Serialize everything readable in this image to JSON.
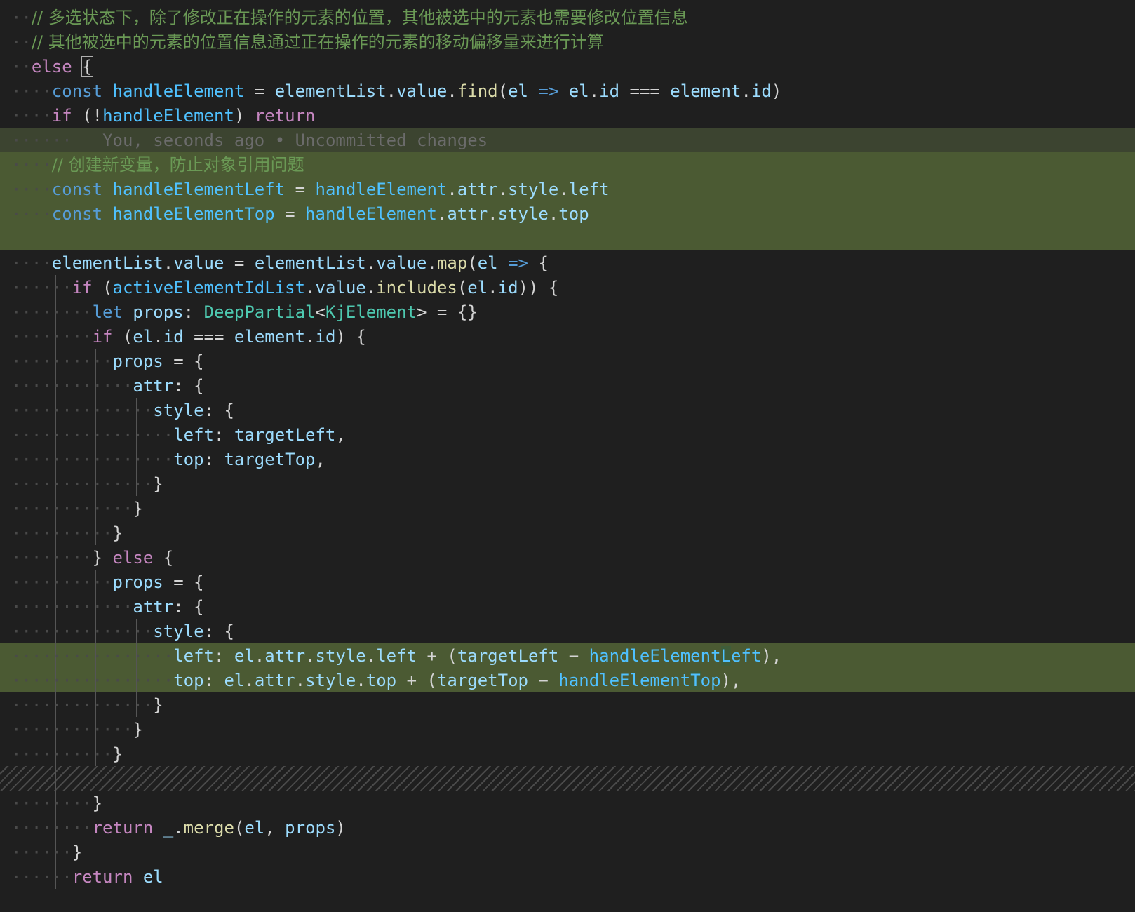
{
  "editor": {
    "blame_text": "You, seconds ago • Uncommitted changes",
    "lines": [
      {
        "indent": 1,
        "tokens": [
          [
            "cm",
            "// 多选状态下，除了修改正在操作的元素的位置，其他被选中的元素也需要修改位置信息"
          ]
        ]
      },
      {
        "indent": 1,
        "tokens": [
          [
            "cm",
            "// 其他被选中的元素的位置信息通过正在操作的元素的移动偏移量来进行计算"
          ]
        ]
      },
      {
        "indent": 1,
        "tokens": [
          [
            "kw",
            "else"
          ],
          [
            "pu",
            " "
          ],
          [
            "bracket",
            "{"
          ]
        ]
      },
      {
        "indent": 2,
        "tokens": [
          [
            "st",
            "const"
          ],
          [
            "pu",
            " "
          ],
          [
            "cn",
            "handleElement"
          ],
          [
            "op",
            " = "
          ],
          [
            "va",
            "elementList"
          ],
          [
            "pu",
            "."
          ],
          [
            "pr",
            "value"
          ],
          [
            "pu",
            "."
          ],
          [
            "fn",
            "find"
          ],
          [
            "pu",
            "("
          ],
          [
            "va",
            "el"
          ],
          [
            "pu",
            " "
          ],
          [
            "st",
            "=>"
          ],
          [
            "pu",
            " "
          ],
          [
            "va",
            "el"
          ],
          [
            "pu",
            "."
          ],
          [
            "pr",
            "id"
          ],
          [
            "op",
            " === "
          ],
          [
            "va",
            "element"
          ],
          [
            "pu",
            "."
          ],
          [
            "pr",
            "id"
          ],
          [
            "pu",
            ")"
          ]
        ]
      },
      {
        "indent": 2,
        "tokens": [
          [
            "kw",
            "if"
          ],
          [
            "pu",
            " ("
          ],
          [
            "op",
            "!"
          ],
          [
            "cn",
            "handleElement"
          ],
          [
            "pu",
            ") "
          ],
          [
            "kw",
            "return"
          ]
        ]
      },
      {
        "indent": 0,
        "blame": true,
        "tokens": []
      },
      {
        "indent": 2,
        "tokens": [
          [
            "cm",
            "// 创建新变量，防止对象引用问题"
          ]
        ]
      },
      {
        "indent": 2,
        "tokens": [
          [
            "st",
            "const"
          ],
          [
            "pu",
            " "
          ],
          [
            "cn",
            "handleElementLeft"
          ],
          [
            "op",
            " = "
          ],
          [
            "cn",
            "handleElement"
          ],
          [
            "pu",
            "."
          ],
          [
            "pr",
            "attr"
          ],
          [
            "pu",
            "."
          ],
          [
            "pr",
            "style"
          ],
          [
            "pu",
            "."
          ],
          [
            "pr",
            "left"
          ]
        ]
      },
      {
        "indent": 2,
        "tokens": [
          [
            "st",
            "const"
          ],
          [
            "pu",
            " "
          ],
          [
            "cn",
            "handleElementTop"
          ],
          [
            "op",
            " = "
          ],
          [
            "cn",
            "handleElement"
          ],
          [
            "pu",
            "."
          ],
          [
            "pr",
            "attr"
          ],
          [
            "pu",
            "."
          ],
          [
            "pr",
            "style"
          ],
          [
            "pu",
            "."
          ],
          [
            "pr",
            "top"
          ]
        ]
      },
      {
        "indent": 0,
        "tokens": []
      },
      {
        "indent": 2,
        "tokens": [
          [
            "va",
            "elementList"
          ],
          [
            "pu",
            "."
          ],
          [
            "pr",
            "value"
          ],
          [
            "op",
            " = "
          ],
          [
            "va",
            "elementList"
          ],
          [
            "pu",
            "."
          ],
          [
            "pr",
            "value"
          ],
          [
            "pu",
            "."
          ],
          [
            "fn",
            "map"
          ],
          [
            "pu",
            "("
          ],
          [
            "va",
            "el"
          ],
          [
            "pu",
            " "
          ],
          [
            "st",
            "=>"
          ],
          [
            "pu",
            " {"
          ]
        ]
      },
      {
        "indent": 3,
        "tokens": [
          [
            "kw",
            "if"
          ],
          [
            "pu",
            " ("
          ],
          [
            "cn",
            "activeElementIdList"
          ],
          [
            "pu",
            "."
          ],
          [
            "pr",
            "value"
          ],
          [
            "pu",
            "."
          ],
          [
            "fn",
            "includes"
          ],
          [
            "pu",
            "("
          ],
          [
            "va",
            "el"
          ],
          [
            "pu",
            "."
          ],
          [
            "pr",
            "id"
          ],
          [
            "pu",
            ")) {"
          ]
        ]
      },
      {
        "indent": 4,
        "tokens": [
          [
            "st",
            "let"
          ],
          [
            "pu",
            " "
          ],
          [
            "va",
            "props"
          ],
          [
            "pu",
            ": "
          ],
          [
            "ty",
            "DeepPartial"
          ],
          [
            "pu",
            "<"
          ],
          [
            "ty",
            "KjElement"
          ],
          [
            "pu",
            ">"
          ],
          [
            "op",
            " = "
          ],
          [
            "pu",
            "{}"
          ]
        ]
      },
      {
        "indent": 4,
        "tokens": [
          [
            "kw",
            "if"
          ],
          [
            "pu",
            " ("
          ],
          [
            "va",
            "el"
          ],
          [
            "pu",
            "."
          ],
          [
            "pr",
            "id"
          ],
          [
            "op",
            " === "
          ],
          [
            "va",
            "element"
          ],
          [
            "pu",
            "."
          ],
          [
            "pr",
            "id"
          ],
          [
            "pu",
            ") {"
          ]
        ]
      },
      {
        "indent": 5,
        "tokens": [
          [
            "va",
            "props"
          ],
          [
            "op",
            " = "
          ],
          [
            "pu",
            "{"
          ]
        ]
      },
      {
        "indent": 6,
        "tokens": [
          [
            "pr",
            "attr"
          ],
          [
            "pu",
            ": {"
          ]
        ]
      },
      {
        "indent": 7,
        "tokens": [
          [
            "pr",
            "style"
          ],
          [
            "pu",
            ": {"
          ]
        ]
      },
      {
        "indent": 8,
        "tokens": [
          [
            "pr",
            "left"
          ],
          [
            "pu",
            ": "
          ],
          [
            "va",
            "targetLeft"
          ],
          [
            "pu",
            ","
          ]
        ]
      },
      {
        "indent": 8,
        "tokens": [
          [
            "pr",
            "top"
          ],
          [
            "pu",
            ": "
          ],
          [
            "va",
            "targetTop"
          ],
          [
            "pu",
            ","
          ]
        ]
      },
      {
        "indent": 7,
        "tokens": [
          [
            "pu",
            "}"
          ]
        ]
      },
      {
        "indent": 6,
        "tokens": [
          [
            "pu",
            "}"
          ]
        ]
      },
      {
        "indent": 5,
        "tokens": [
          [
            "pu",
            "}"
          ]
        ]
      },
      {
        "indent": 4,
        "tokens": [
          [
            "pu",
            "} "
          ],
          [
            "kw",
            "else"
          ],
          [
            "pu",
            " {"
          ]
        ]
      },
      {
        "indent": 5,
        "tokens": [
          [
            "va",
            "props"
          ],
          [
            "op",
            " = "
          ],
          [
            "pu",
            "{"
          ]
        ]
      },
      {
        "indent": 6,
        "tokens": [
          [
            "pr",
            "attr"
          ],
          [
            "pu",
            ": {"
          ]
        ]
      },
      {
        "indent": 7,
        "tokens": [
          [
            "pr",
            "style"
          ],
          [
            "pu",
            ": {"
          ]
        ]
      },
      {
        "indent": 8,
        "tokens": [
          [
            "pr",
            "left"
          ],
          [
            "pu",
            ": "
          ],
          [
            "va",
            "el"
          ],
          [
            "pu",
            "."
          ],
          [
            "pr",
            "attr"
          ],
          [
            "pu",
            "."
          ],
          [
            "pr",
            "style"
          ],
          [
            "pu",
            "."
          ],
          [
            "pr",
            "left"
          ],
          [
            "op",
            " + "
          ],
          [
            "pu",
            "("
          ],
          [
            "va",
            "targetLeft"
          ],
          [
            "op",
            " − "
          ],
          [
            "cn",
            "handleElement"
          ],
          [
            "occ",
            "L"
          ],
          [
            "cn",
            "eft"
          ],
          [
            "pu",
            "),"
          ]
        ]
      },
      {
        "indent": 8,
        "tokens": [
          [
            "pr",
            "top"
          ],
          [
            "pu",
            ": "
          ],
          [
            "va",
            "el"
          ],
          [
            "pu",
            "."
          ],
          [
            "pr",
            "attr"
          ],
          [
            "pu",
            "."
          ],
          [
            "pr",
            "style"
          ],
          [
            "pu",
            "."
          ],
          [
            "pr",
            "top"
          ],
          [
            "op",
            " + "
          ],
          [
            "pu",
            "("
          ],
          [
            "va",
            "targetTop"
          ],
          [
            "op",
            " − "
          ],
          [
            "cn",
            "handleElement"
          ],
          [
            "occ",
            "T"
          ],
          [
            "cn",
            "op"
          ],
          [
            "pu",
            "),"
          ]
        ]
      },
      {
        "indent": 7,
        "tokens": [
          [
            "pu",
            "}"
          ]
        ]
      },
      {
        "indent": 6,
        "tokens": [
          [
            "pu",
            "}"
          ]
        ]
      },
      {
        "indent": 5,
        "tokens": [
          [
            "pu",
            "}"
          ]
        ]
      },
      {
        "indent": 0,
        "hatch": true,
        "tokens": []
      },
      {
        "indent": 4,
        "tokens": [
          [
            "pu",
            "}"
          ]
        ]
      },
      {
        "indent": 4,
        "tokens": [
          [
            "kw",
            "return"
          ],
          [
            "pu",
            " "
          ],
          [
            "va",
            "_"
          ],
          [
            "pu",
            "."
          ],
          [
            "fn",
            "merge"
          ],
          [
            "pu",
            "("
          ],
          [
            "va",
            "el"
          ],
          [
            "pu",
            ", "
          ],
          [
            "va",
            "props"
          ],
          [
            "pu",
            ")"
          ]
        ]
      },
      {
        "indent": 3,
        "tokens": [
          [
            "pu",
            "}"
          ]
        ]
      },
      {
        "indent": 3,
        "tokens": [
          [
            "kw",
            "return"
          ],
          [
            "pu",
            " "
          ],
          [
            "va",
            "el"
          ]
        ]
      }
    ]
  }
}
